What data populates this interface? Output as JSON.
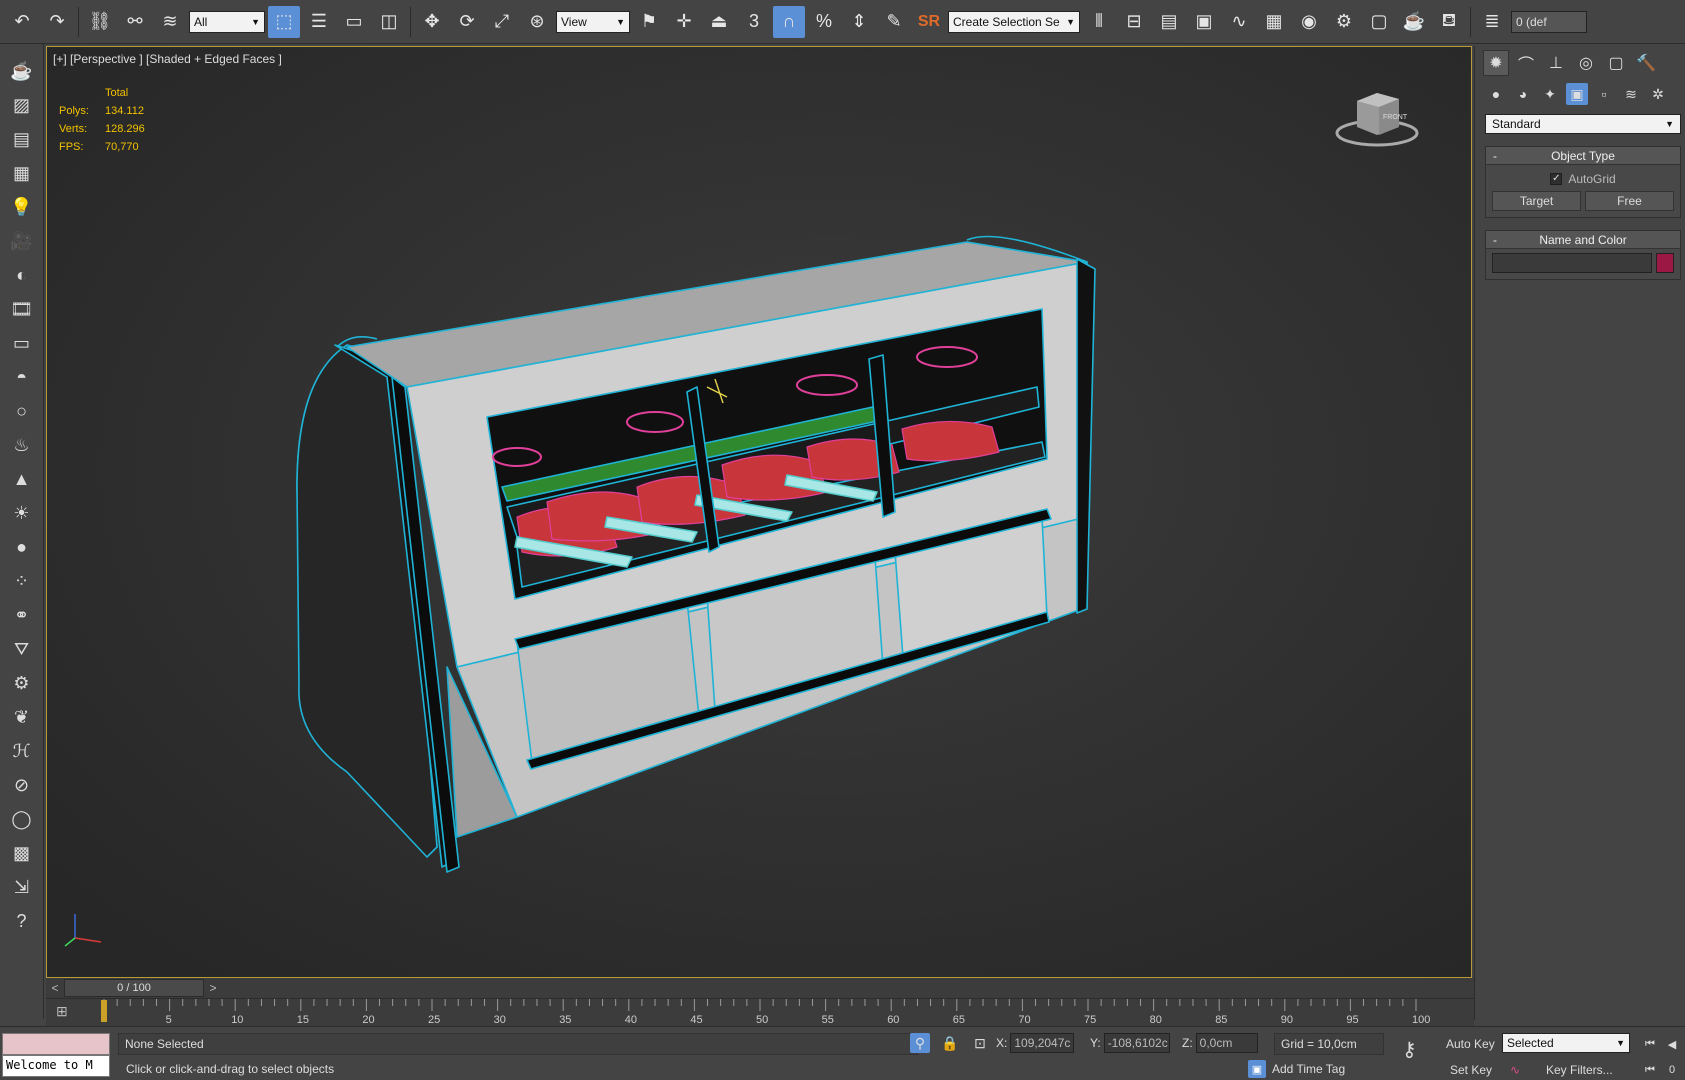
{
  "toolbar": {
    "filter_select": "All",
    "ref_coord_select": "View",
    "snap_label": "3",
    "sr_label": "SR",
    "selection_set_placeholder": "Create Selection Se",
    "layer_label": "0 (def"
  },
  "viewport": {
    "label": "[+] [Perspective ] [Shaded + Edged Faces ]",
    "stats": {
      "total_label": "Total",
      "polys_label": "Polys:",
      "polys_value": "134.112",
      "verts_label": "Verts:",
      "verts_value": "128.296",
      "fps_label": "FPS:",
      "fps_value": "70,770"
    },
    "viewcube_label": "FRONT"
  },
  "command_panel": {
    "category_dropdown": "Standard",
    "object_type": {
      "title": "Object Type",
      "autogrid_label": "AutoGrid",
      "autogrid_checked": true,
      "target_button": "Target",
      "free_button": "Free"
    },
    "name_and_color": {
      "title": "Name and Color",
      "name_value": "",
      "swatch_color": "#9b1744"
    }
  },
  "timeline": {
    "slider_label": "0 / 100",
    "prev": "<",
    "next": ">",
    "ticks": [
      "5",
      "10",
      "15",
      "20",
      "25",
      "30",
      "35",
      "40",
      "45",
      "50",
      "55",
      "60",
      "65",
      "70",
      "75",
      "80",
      "85",
      "90",
      "95",
      "100"
    ]
  },
  "statusbar": {
    "maxscript_text": "Welcome to M",
    "selection_info": "None Selected",
    "prompt": "Click or click-and-drag to select objects",
    "x_label": "X:",
    "x_value": "109,2047c",
    "y_label": "Y:",
    "y_value": "-108,6102c",
    "z_label": "Z:",
    "z_value": "0,0cm",
    "grid_info": "Grid = 10,0cm",
    "add_time_tag": "Add Time Tag",
    "auto_key": "Auto Key",
    "set_key": "Set Key",
    "key_filter_select": "Selected",
    "key_filters": "Key Filters..."
  },
  "colors": {
    "accent": "#5b8fd6",
    "wire_edge": "#1fb3d6",
    "meat_wire": "#e0409a",
    "stats_text": "#f2c200",
    "viewport_border": "#b99a3b"
  }
}
